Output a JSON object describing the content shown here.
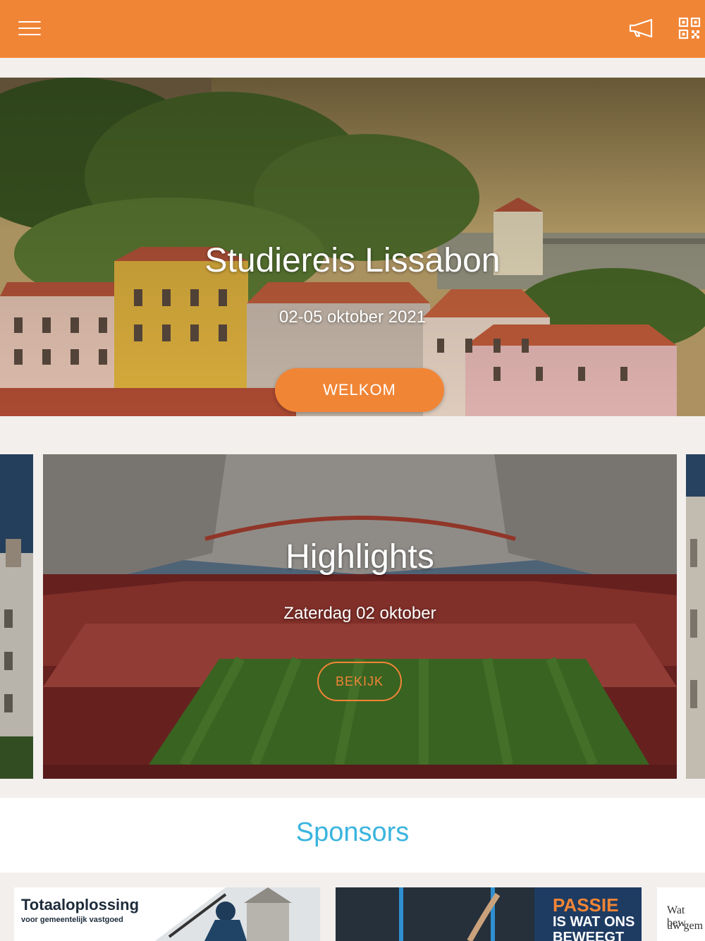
{
  "header": {
    "menu_icon": "hamburger-menu-icon",
    "announcement_icon": "megaphone-icon",
    "qr_icon": "qr-code-icon",
    "background_color": "#f18536"
  },
  "hero": {
    "title": "Studiereis Lissabon",
    "subtitle": "02-05 oktober 2021",
    "button_label": "WELKOM"
  },
  "carousel": {
    "active_slide": {
      "title": "Highlights",
      "subtitle": "Zaterdag 02 oktober",
      "button_label": "BEKIJK"
    }
  },
  "sponsors": {
    "title": "Sponsors",
    "cards": [
      {
        "headline": "Totaaloplossing",
        "tagline": "voor gemeentelijk vastgoed"
      },
      {
        "line1": "PASSIE",
        "line2": "IS WAT ONS",
        "line3": "BEWEEGT"
      },
      {
        "line1": "Wat bew",
        "line2": "uw gem"
      }
    ]
  },
  "colors": {
    "accent": "#f18536",
    "sponsors_title": "#3ab4de",
    "page_background": "#f2efed"
  }
}
